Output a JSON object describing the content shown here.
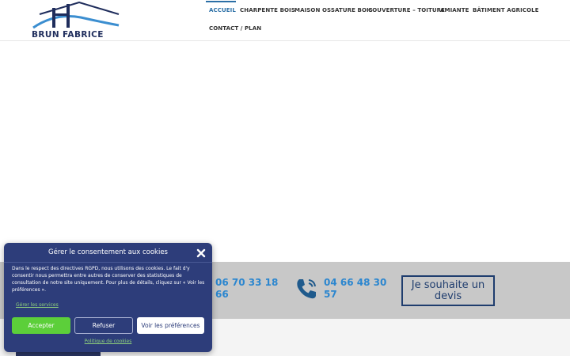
{
  "header": {
    "logo_text": "BRUN FABRICE",
    "nav": [
      {
        "label": "ACCUEIL",
        "active": true
      },
      {
        "label": "CHARPENTE BOIS"
      },
      {
        "label": "MAISON OSSATURE BOIS"
      },
      {
        "label": "COUVERTURE – TOITURE"
      },
      {
        "label": "AMIANTE"
      },
      {
        "label": "BÂTIMENT AGRICOLE"
      },
      {
        "label": "CONTACT / PLAN"
      }
    ]
  },
  "contact": {
    "phone1": "06 70 33 18 66",
    "phone2": "04 66 48 30 57",
    "devis_label": "Je souhaite un devis",
    "phone_icon": "phone-icon"
  },
  "cookie": {
    "title": "Gérer le consentement aux cookies",
    "text": "Dans le respect des directives RGPD, nous utilisons des cookies. Le fait d'y consentir nous permettra entre autres de conserver des statistiques de consultation de notre site uniquement. Pour plus de détails, cliquez sur « Voir les préférences ».",
    "manage_label": "Gérer les services",
    "accept_label": "Accepter",
    "refuse_label": "Refuser",
    "prefs_label": "Voir les préférences",
    "policy_label": "Politique de cookies"
  },
  "colors": {
    "accent": "#2b6fa6",
    "phone_blue": "#2b86cf",
    "modal_bg": "#2d3d7a",
    "accept_green": "#5ccf3a",
    "band_gray": "#c8c8c8"
  }
}
